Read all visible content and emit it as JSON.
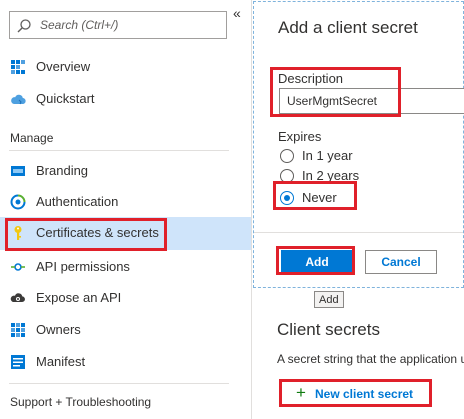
{
  "sidebar": {
    "search_placeholder": "Search (Ctrl+/)",
    "collapse_glyph": "«",
    "top_items": [
      {
        "label": "Overview",
        "icon": "overview-grid-icon"
      },
      {
        "label": "Quickstart",
        "icon": "cloud-icon"
      }
    ],
    "manage_header": "Manage",
    "manage_items": [
      {
        "label": "Branding",
        "icon": "branding-icon"
      },
      {
        "label": "Authentication",
        "icon": "authentication-icon"
      },
      {
        "label": "Certificates & secrets",
        "icon": "key-icon",
        "active": true
      },
      {
        "label": "API permissions",
        "icon": "api-permissions-icon"
      },
      {
        "label": "Expose an API",
        "icon": "cloud-gear-icon"
      },
      {
        "label": "Owners",
        "icon": "owners-grid-icon"
      },
      {
        "label": "Manifest",
        "icon": "manifest-icon"
      }
    ],
    "support_header": "Support + Troubleshooting"
  },
  "panel": {
    "title": "Add a client secret",
    "description_label": "Description",
    "description_value": "UserMgmtSecret",
    "expires_label": "Expires",
    "expires_options": [
      {
        "label": "In 1 year",
        "checked": false
      },
      {
        "label": "In 2 years",
        "checked": false
      },
      {
        "label": "Never",
        "checked": true
      }
    ],
    "add_button": "Add",
    "cancel_button": "Cancel"
  },
  "tooltip": "Add",
  "client_secrets": {
    "title": "Client secrets",
    "description": "A secret string that the application uses to prove its identity when requesting a token.",
    "new_button": "New client secret"
  },
  "colors": {
    "accent": "#0078d4",
    "active_nav": "#cfe4fa",
    "highlight": "#e0202a",
    "plus": "#107c10"
  }
}
